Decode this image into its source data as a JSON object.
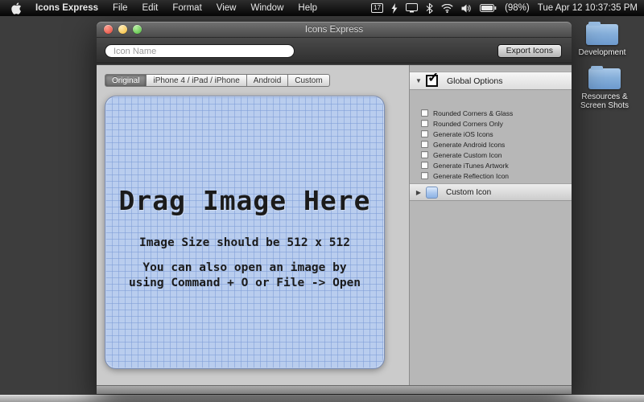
{
  "menu_bar": {
    "app_name": "Icons Express",
    "menus": [
      "File",
      "Edit",
      "Format",
      "View",
      "Window",
      "Help"
    ],
    "status": {
      "input_badge": "17",
      "battery_percent": "(98%)",
      "clock": "Tue Apr 12 10:37:35 PM"
    }
  },
  "icons": {
    "disclosure_down": "▼",
    "disclosure_right": "▶",
    "checkmark": "✓"
  },
  "window": {
    "title": "Icons Express",
    "toolbar": {
      "icon_name_placeholder": "Icon Name",
      "export_button_label": "Export Icons"
    },
    "tabs": [
      {
        "label": "Original",
        "selected": true
      },
      {
        "label": "iPhone 4 / iPad / iPhone",
        "selected": false
      },
      {
        "label": "Android",
        "selected": false
      },
      {
        "label": "Custom",
        "selected": false
      }
    ],
    "drop_area": {
      "title": "Drag Image Here",
      "subtitle": "Image Size should be 512 x 512",
      "hint_line1": "You can also open an image by",
      "hint_line2": "using Command + O or File -> Open"
    },
    "sidebar": {
      "global_options_label": "Global Options",
      "global_options_checked": true,
      "options": [
        {
          "label": "Rounded Corners & Glass",
          "checked": false
        },
        {
          "label": "Rounded Corners Only",
          "checked": false
        },
        {
          "label": "Generate iOS Icons",
          "checked": false
        },
        {
          "label": "Generate Android Icons",
          "checked": false
        },
        {
          "label": "Generate Custom Icon",
          "checked": false
        },
        {
          "label": "Generate iTunes Artwork",
          "checked": false
        },
        {
          "label": "Generate Reflection Icon",
          "checked": false
        }
      ],
      "custom_icon_label": "Custom Icon"
    }
  },
  "desktop": {
    "icons": [
      {
        "label": "Development"
      },
      {
        "label": "Resources & Screen Shots"
      }
    ]
  }
}
